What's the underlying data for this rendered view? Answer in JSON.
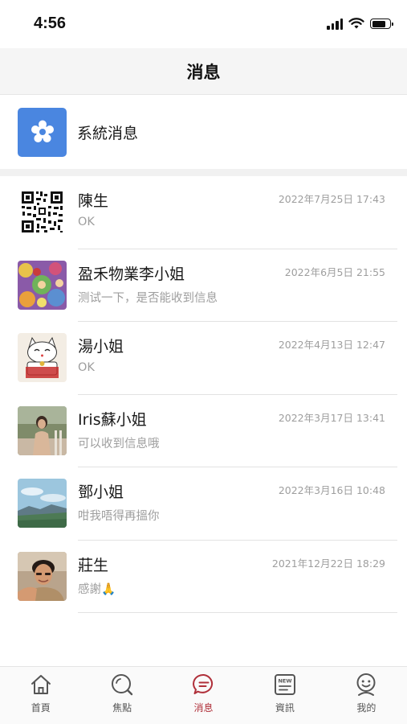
{
  "status_bar": {
    "time": "4:56",
    "battery_level": 0.8
  },
  "header": {
    "title": "消息"
  },
  "system": {
    "label": "系統消息",
    "icon": "gear-icon",
    "icon_color": "#4a86e0"
  },
  "conversations": [
    {
      "name": "陳生",
      "time": "2022年7月25日 17:43",
      "preview": "OK",
      "avatar": "qr-code-avatar"
    },
    {
      "name": "盈禾物業李小姐",
      "time": "2022年6月5日 21:55",
      "preview": "测试一下，是否能收到信息",
      "avatar": "artwork-avatar"
    },
    {
      "name": "湯小姐",
      "time": "2022年4月13日 12:47",
      "preview": "OK",
      "avatar": "lucky-cat-avatar"
    },
    {
      "name": "Iris蘇小姐",
      "time": "2022年3月17日 13:41",
      "preview": "可以收到信息哦",
      "avatar": "photo-avatar"
    },
    {
      "name": "鄧小姐",
      "time": "2022年3月16日 10:48",
      "preview": "咁我唔得再搵你",
      "avatar": "landscape-avatar"
    },
    {
      "name": "莊生",
      "time": "2021年12月22日 18:29",
      "preview": "感謝🙏",
      "avatar": "portrait-avatar"
    }
  ],
  "tabs": [
    {
      "label": "首頁",
      "icon": "home-icon",
      "active": false
    },
    {
      "label": "焦點",
      "icon": "search-icon",
      "active": false
    },
    {
      "label": "消息",
      "icon": "chat-icon",
      "active": true
    },
    {
      "label": "資訊",
      "icon": "news-icon",
      "active": false
    },
    {
      "label": "我的",
      "icon": "profile-icon",
      "active": false
    }
  ],
  "colors": {
    "accent": "#b0303a",
    "system_icon_bg": "#4a86e0",
    "muted_text": "#9e9e9e"
  }
}
